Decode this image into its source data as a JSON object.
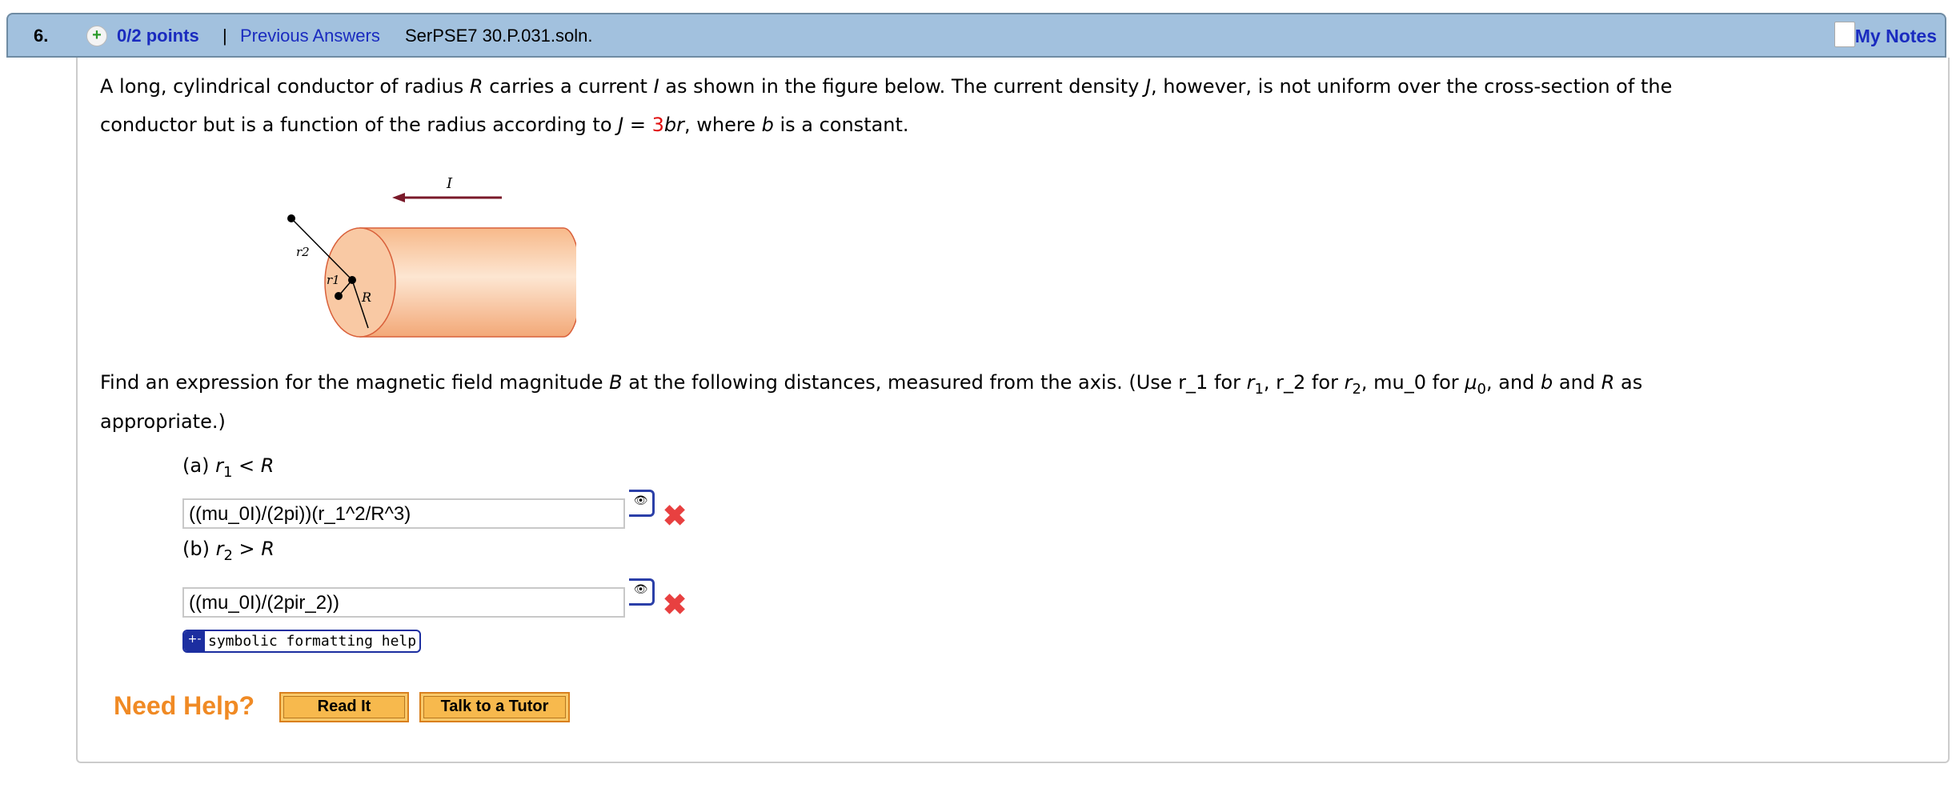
{
  "header": {
    "number": "6.",
    "points": "0/2 points",
    "separator": "|",
    "previous_answers": "Previous Answers",
    "code": "SerPSE7 30.P.031.soln.",
    "my_notes": "My Notes",
    "plus_icon": "plus-circle-icon",
    "notes_icon": "document-icon"
  },
  "problem": {
    "line1_a": "A long, cylindrical conductor of radius ",
    "R": "R",
    "line1_b": " carries a current ",
    "I": "I",
    "line1_c": " as shown in the figure below. The current density ",
    "J": "J",
    "line1_d": ", however, is not uniform over the cross-section of the",
    "line2_a": "conductor but is a function of the radius according to ",
    "J2": "J",
    "line2_b": " = ",
    "coef": "3",
    "br": "br",
    "line2_c": ", where ",
    "b": "b",
    "line2_d": " is a constant."
  },
  "figure": {
    "label_I": "I",
    "label_r2": "r2",
    "label_r1": "r1",
    "label_R": "R"
  },
  "question": {
    "q_a": "Find an expression for the magnetic field magnitude ",
    "B": "B",
    "q_b": " at the following distances, measured from the axis. (Use r_1 for ",
    "r1": "r",
    "s1": "1",
    "q_c": ", r_2 for ",
    "r2": "r",
    "s2": "2",
    "q_d": ", mu_0 for ",
    "mu": "μ",
    "s0": "0",
    "q_e": ", and ",
    "bb": "b",
    "q_f": " and ",
    "RR": "R",
    "q_g": " as",
    "line2": "appropriate.)"
  },
  "parts": [
    {
      "label": "(a) ",
      "var": "r",
      "sub": "1",
      "rel": " < ",
      "R": "R",
      "answer": "((mu_0I)/(2pi))(r_1^2/R^3)",
      "status": "incorrect"
    },
    {
      "label": "(b) ",
      "var": "r",
      "sub": "2",
      "rel": " > ",
      "R": "R",
      "answer": "((mu_0I)/(2pir_2))",
      "status": "incorrect"
    }
  ],
  "help_link": "symbolic formatting help",
  "need_help": "Need Help?",
  "buttons": {
    "read_it": "Read It",
    "tutor": "Talk to a Tutor"
  },
  "colors": {
    "header": "#a2c1de",
    "link": "#1a2bbf",
    "accent_red": "#e01010",
    "need_help": "#f08a24",
    "button": "#f7b94d"
  }
}
